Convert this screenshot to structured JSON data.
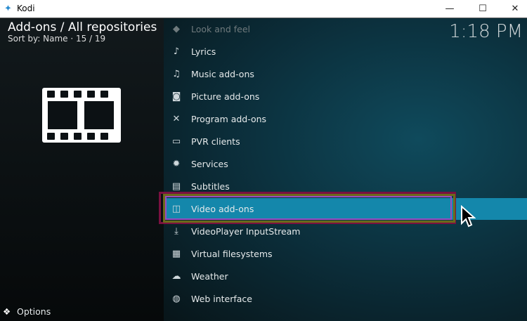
{
  "window": {
    "title": "Kodi",
    "minimize": "—",
    "maximize": "☐",
    "close": "✕"
  },
  "header": {
    "title": "Add-ons / All repositories",
    "sort": "Sort by: Name  ·  15 / 19",
    "clock": "1:18 PM"
  },
  "items": [
    {
      "label": "Look and feel",
      "icon": "paint-bucket-icon",
      "glyph": "◆"
    },
    {
      "label": "Lyrics",
      "icon": "microphone-icon",
      "glyph": "♪"
    },
    {
      "label": "Music add-ons",
      "icon": "music-note-icon",
      "glyph": "♫"
    },
    {
      "label": "Picture add-ons",
      "icon": "camera-icon",
      "glyph": "◙"
    },
    {
      "label": "Program add-ons",
      "icon": "tools-icon",
      "glyph": "✕"
    },
    {
      "label": "PVR clients",
      "icon": "tv-icon",
      "glyph": "▭"
    },
    {
      "label": "Services",
      "icon": "gear-icon",
      "glyph": "✹"
    },
    {
      "label": "Subtitles",
      "icon": "subtitles-icon",
      "glyph": "▤"
    },
    {
      "label": "Video add-ons",
      "icon": "film-icon",
      "glyph": "◫"
    },
    {
      "label": "VideoPlayer InputStream",
      "icon": "download-icon",
      "glyph": "⤓"
    },
    {
      "label": "Virtual filesystems",
      "icon": "filesystem-icon",
      "glyph": "▦"
    },
    {
      "label": "Weather",
      "icon": "weather-icon",
      "glyph": "☁"
    },
    {
      "label": "Web interface",
      "icon": "globe-icon",
      "glyph": "◍"
    }
  ],
  "footer": {
    "options": "Options"
  }
}
